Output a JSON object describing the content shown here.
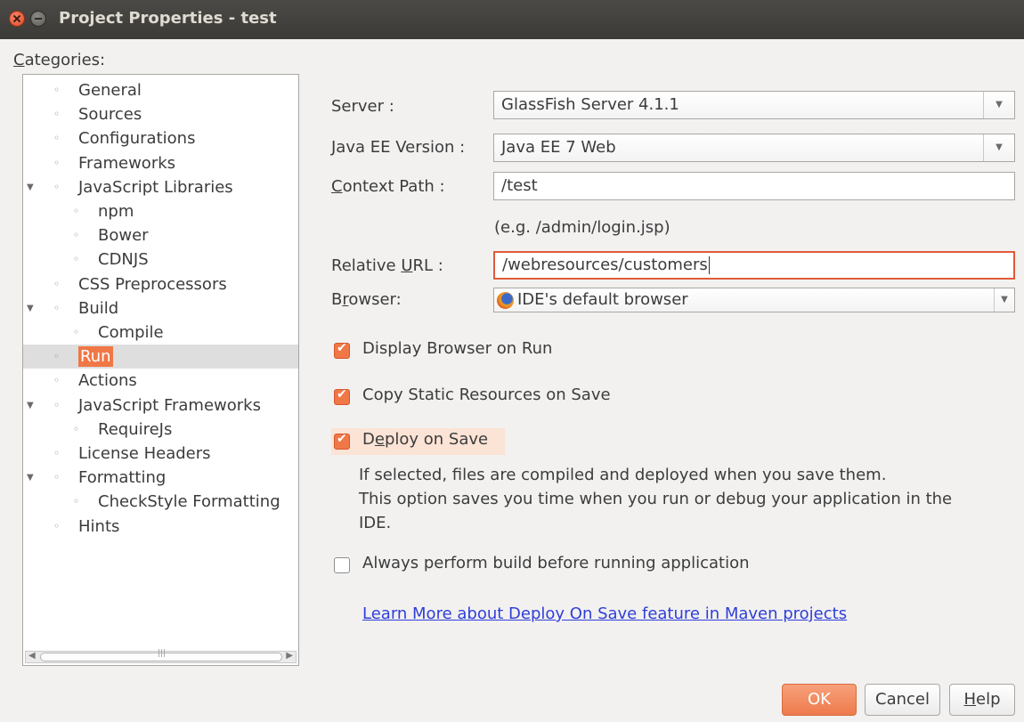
{
  "window": {
    "title": "Project Properties - test",
    "close_icon": "close-icon",
    "minimize_icon": "minimize-icon"
  },
  "categories": {
    "label": "Categories:",
    "items": [
      {
        "label": "General",
        "level": 0,
        "expanded": false
      },
      {
        "label": "Sources",
        "level": 0,
        "expanded": false
      },
      {
        "label": "Configurations",
        "level": 0,
        "expanded": false
      },
      {
        "label": "Frameworks",
        "level": 0,
        "expanded": false
      },
      {
        "label": "JavaScript Libraries",
        "level": 0,
        "expanded": true
      },
      {
        "label": "npm",
        "level": 1,
        "expanded": false
      },
      {
        "label": "Bower",
        "level": 1,
        "expanded": false
      },
      {
        "label": "CDNJS",
        "level": 1,
        "expanded": false
      },
      {
        "label": "CSS Preprocessors",
        "level": 0,
        "expanded": false
      },
      {
        "label": "Build",
        "level": 0,
        "expanded": true
      },
      {
        "label": "Compile",
        "level": 1,
        "expanded": false
      },
      {
        "label": "Run",
        "level": 0,
        "expanded": false,
        "selected": true
      },
      {
        "label": "Actions",
        "level": 0,
        "expanded": false
      },
      {
        "label": "JavaScript Frameworks",
        "level": 0,
        "expanded": true
      },
      {
        "label": "RequireJs",
        "level": 1,
        "expanded": false
      },
      {
        "label": "License Headers",
        "level": 0,
        "expanded": false
      },
      {
        "label": "Formatting",
        "level": 0,
        "expanded": true
      },
      {
        "label": "CheckStyle Formatting",
        "level": 1,
        "expanded": false
      },
      {
        "label": "Hints",
        "level": 0,
        "expanded": false
      }
    ]
  },
  "form": {
    "server_label": "Server :",
    "server_value": "GlassFish Server 4.1.1",
    "javaee_label": "Java EE Version :",
    "javaee_value": "Java EE 7 Web",
    "context_label": "Context Path :",
    "context_value": "/test",
    "context_hint": "(e.g. /admin/login.jsp)",
    "relurl_label": "Relative URL :",
    "relurl_value": "/webresources/customers",
    "browser_label": "Browser:",
    "browser_value": "IDE's default browser",
    "browser_icon": "firefox-icon"
  },
  "options": {
    "display_browser": {
      "label": "Display Browser on Run",
      "checked": true
    },
    "copy_static": {
      "label": "Copy Static Resources on Save",
      "checked": true
    },
    "deploy_on_save": {
      "label": "Deploy on Save",
      "checked": true
    },
    "deploy_desc": [
      "If selected, files are compiled and deployed when you save them.",
      "This option saves you time when you run or debug your application in the",
      "IDE."
    ],
    "always_build": {
      "label": "Always perform build before running application",
      "checked": false
    }
  },
  "learn_more_link": "Learn More about Deploy On Save feature in Maven projects",
  "buttons": {
    "ok": "OK",
    "cancel": "Cancel",
    "help": "Help"
  }
}
